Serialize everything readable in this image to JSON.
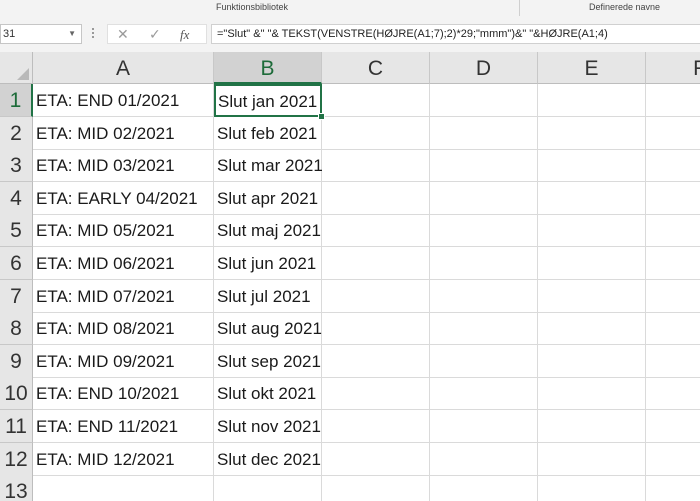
{
  "ribbon": {
    "group_labels": [
      "Funktionsbibliotek",
      "Definerede navne"
    ]
  },
  "formula_bar": {
    "name_box": "B1",
    "name_box_visible": "31",
    "cancel_icon": "x-icon",
    "enter_icon": "check-icon",
    "fx_label": "fx",
    "formula": "=\"Slut\" &\" \"& TEKST(VENSTRE(HØJRE(A1;7);2)*29;\"mmm\")&\" \"&HØJRE(A1;4)"
  },
  "columns": [
    "A",
    "B",
    "C",
    "D",
    "E",
    "F"
  ],
  "rows": [
    {
      "number": "1",
      "a": "ETA: END 01/2021",
      "b": "Slut jan 2021"
    },
    {
      "number": "2",
      "a": "ETA: MID 02/2021",
      "b": "Slut feb 2021"
    },
    {
      "number": "3",
      "a": "ETA: MID 03/2021",
      "b": "Slut mar 2021"
    },
    {
      "number": "4",
      "a": "ETA: EARLY 04/2021",
      "b": "Slut apr 2021"
    },
    {
      "number": "5",
      "a": "ETA: MID 05/2021",
      "b": "Slut maj 2021"
    },
    {
      "number": "6",
      "a": "ETA: MID 06/2021",
      "b": "Slut jun 2021"
    },
    {
      "number": "7",
      "a": "ETA: MID 07/2021",
      "b": "Slut jul 2021"
    },
    {
      "number": "8",
      "a": "ETA: MID 08/2021",
      "b": "Slut aug 2021"
    },
    {
      "number": "9",
      "a": "ETA: MID 09/2021",
      "b": "Slut sep 2021"
    },
    {
      "number": "10",
      "a": "ETA: END 10/2021",
      "b": "Slut okt 2021"
    },
    {
      "number": "11",
      "a": "ETA: END 11/2021",
      "b": "Slut nov 2021"
    },
    {
      "number": "12",
      "a": "ETA: MID 12/2021",
      "b": "Slut dec 2021"
    },
    {
      "number": "13",
      "a": "",
      "b": ""
    }
  ],
  "selection": {
    "column": "B",
    "row": "1"
  },
  "colors": {
    "accent": "#217346",
    "header_bg": "#e6e6e6",
    "selected_header_bg": "#d2d2d2"
  }
}
